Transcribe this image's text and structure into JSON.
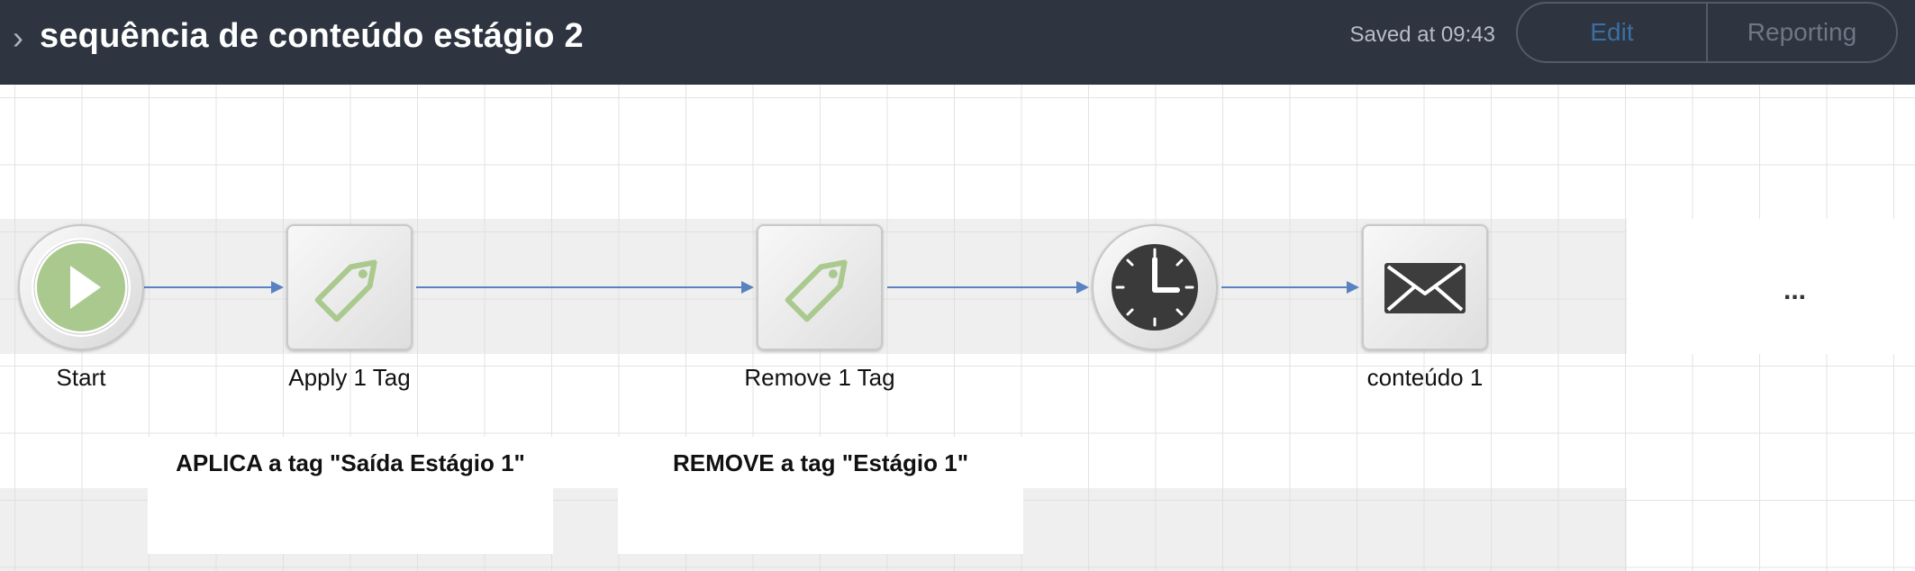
{
  "header": {
    "title": "sequência de conteúdo estágio 2",
    "saved_text": "Saved at 09:43",
    "tabs": {
      "edit": "Edit",
      "reporting": "Reporting"
    }
  },
  "flow": {
    "nodes": [
      {
        "label": "Start",
        "icon": "play-icon"
      },
      {
        "label": "Apply 1 Tag",
        "icon": "tag-icon"
      },
      {
        "label": "Remove 1 Tag",
        "icon": "tag-icon"
      },
      {
        "label": "",
        "icon": "clock-icon"
      },
      {
        "label": "conteúdo 1",
        "icon": "envelope-icon"
      }
    ],
    "more": "...",
    "notes": [
      "APLICA a tag \"Saída Estágio 1\"",
      "REMOVE a tag \"Estágio 1\""
    ]
  },
  "colors": {
    "header_bg": "#2e3440",
    "edge": "#5b82c0",
    "edit_accent": "#3a6fa3",
    "start_green": "#a9c98e"
  }
}
